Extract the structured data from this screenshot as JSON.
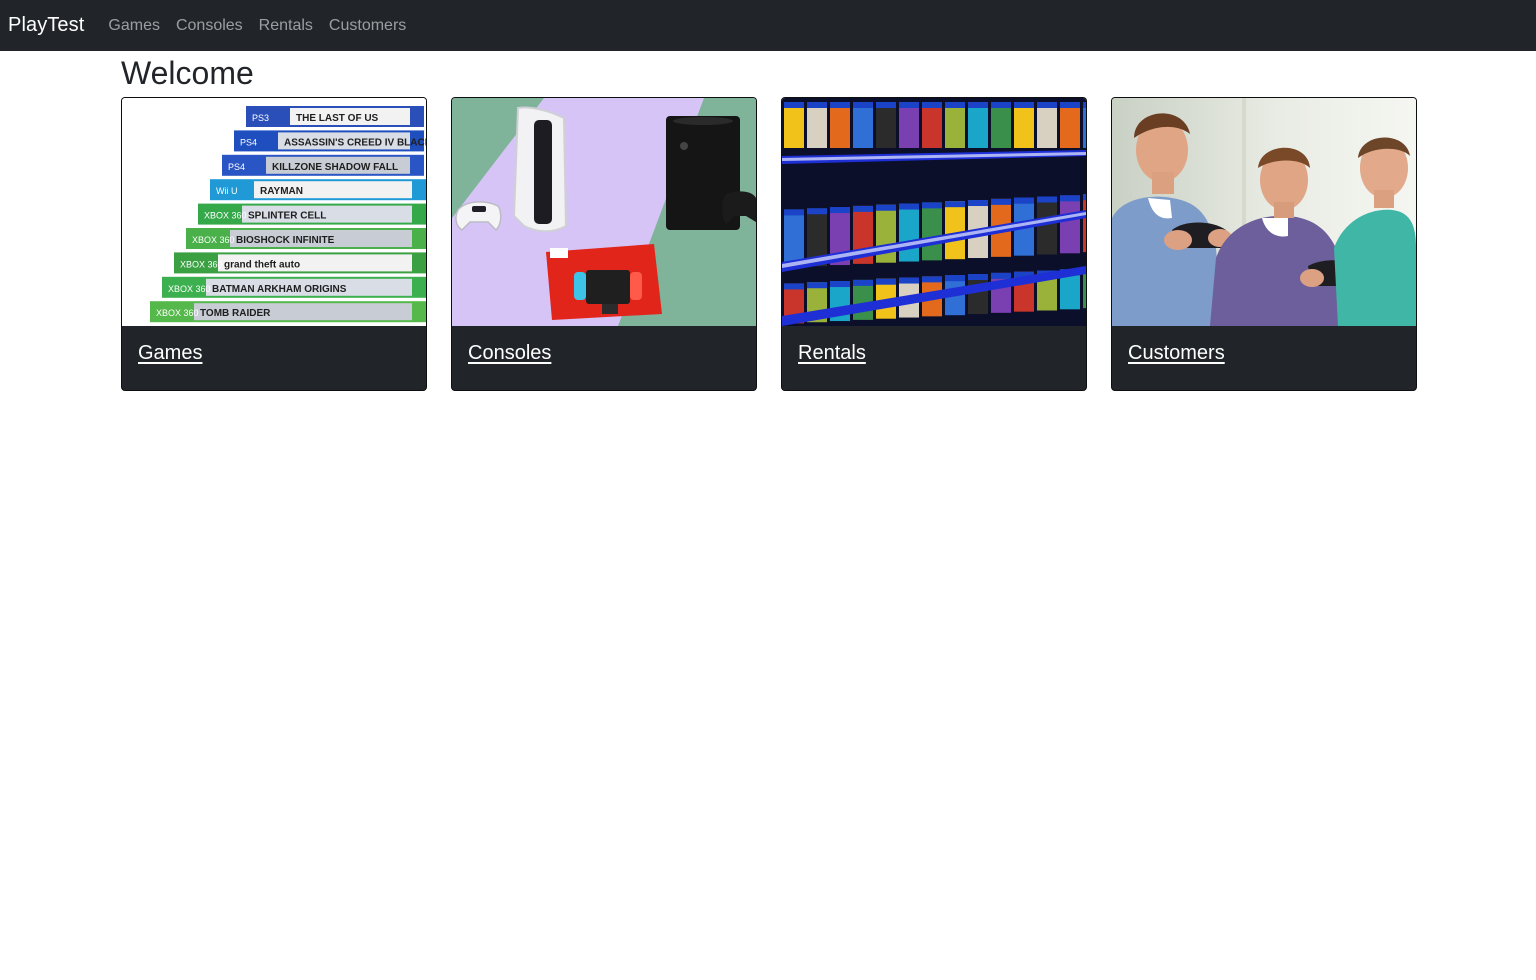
{
  "navbar": {
    "brand": "PlayTest",
    "links": [
      "Games",
      "Consoles",
      "Rentals",
      "Customers"
    ],
    "background": "#212529"
  },
  "page": {
    "title": "Welcome"
  },
  "cards": [
    {
      "label": "Games",
      "image": "game-case-stack-image"
    },
    {
      "label": "Consoles",
      "image": "consoles-image"
    },
    {
      "label": "Rentals",
      "image": "store-shelf-image"
    },
    {
      "label": "Customers",
      "image": "friends-gaming-image"
    }
  ],
  "games_image": {
    "case_labels": [
      "THE LAST OF US",
      "ASSASSIN'S CREED IV BLACK FLAG",
      "KILLZONE SHADOW FALL",
      "RAYMAN",
      "SPLINTER CELL",
      "BIOSHOCK INFINITE",
      "grand theft auto",
      "BATMAN ARKHAM ORIGINS",
      "TOMB RAIDER"
    ],
    "platform_labels": [
      "PS3",
      "PS4",
      "PS4",
      "Wii U",
      "XBOX 360",
      "XBOX 360",
      "XBOX 360",
      "XBOX 360",
      "XBOX 360"
    ]
  }
}
